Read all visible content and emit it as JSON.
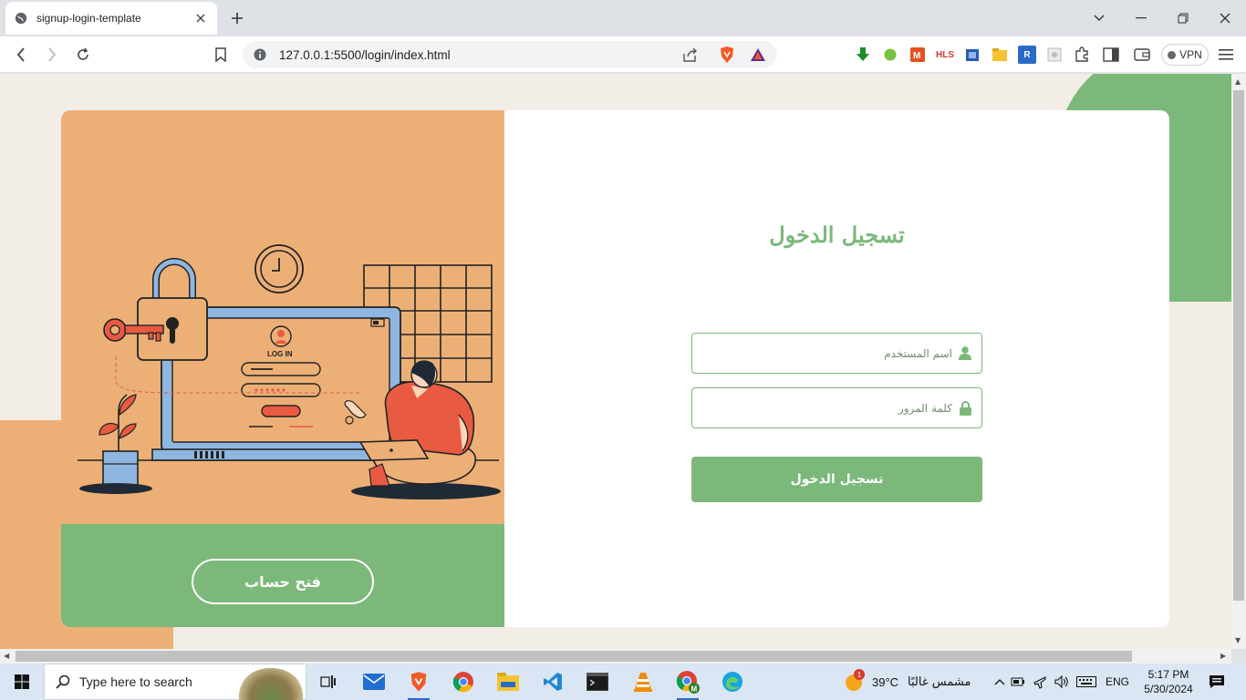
{
  "browser": {
    "tab_title": "signup-login-template",
    "url": "127.0.0.1:5500/login/index.html",
    "vpn_label": "VPN",
    "hls_label": "HLS",
    "r_label": "R"
  },
  "page": {
    "illustration_label": "LOG IN",
    "signup_button": "فتح حساب",
    "form_title": "تسجيل الدخول",
    "username_placeholder": "اسم المستخدم",
    "password_placeholder": "كلمة المرور",
    "login_button": "تسجيل الدخول",
    "colors": {
      "accent_green": "#7cb87a",
      "accent_orange": "#ecb077"
    }
  },
  "taskbar": {
    "search_placeholder": "Type here to search",
    "weather_temp": "39°C",
    "weather_text": "مشمس غالبًا",
    "weather_badge": "1",
    "language": "ENG",
    "time": "5:17 PM",
    "date": "5/30/2024"
  }
}
